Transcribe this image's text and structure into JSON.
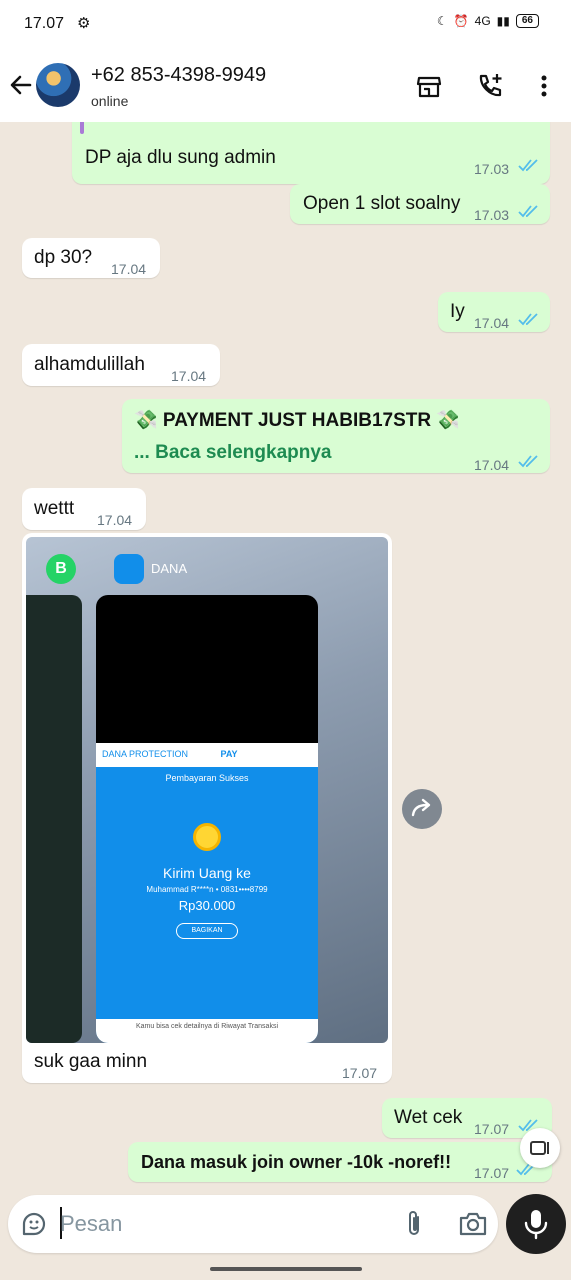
{
  "status_bar": {
    "time": "17.07",
    "network": "4G",
    "battery": "66"
  },
  "header": {
    "contact_name": "+62 853-4398-9949",
    "status": "online"
  },
  "messages": [
    {
      "direction": "out",
      "text": "DP aja dlu sung admin",
      "time": "17.03",
      "read": true
    },
    {
      "direction": "out",
      "text": "Open 1 slot soalny",
      "time": "17.03",
      "read": true
    },
    {
      "direction": "in",
      "text": "dp 30?",
      "time": "17.04"
    },
    {
      "direction": "out",
      "text": "Iy",
      "time": "17.04",
      "read": true
    },
    {
      "direction": "in",
      "text": "alhamdulillah",
      "time": "17.04"
    },
    {
      "direction": "out",
      "text": "💸 PAYMENT JUST HABIB17STR 💸",
      "more": "... Baca selengkapnya",
      "time": "17.04",
      "read": true
    },
    {
      "direction": "in",
      "text": "wettt",
      "time": "17.04"
    },
    {
      "direction": "in",
      "type": "image",
      "caption": "suk gaa minn",
      "time": "17.07"
    },
    {
      "direction": "out",
      "text": "Wet cek",
      "time": "17.07",
      "read": true
    },
    {
      "direction": "out",
      "text": "Dana masuk join owner -10k -noref!!",
      "time": "17.07",
      "read": true
    }
  ],
  "image_content": {
    "app_label": "DANA",
    "brand_left": "DANA PROTECTION",
    "brand_right": "PAY",
    "title": "Pembayaran Sukses",
    "send": "Kirim Uang ke",
    "recipient": "Muhammad R****n • 0831••••8799",
    "amount": "Rp30.000",
    "share": "BAGIKAN",
    "footer": "Kamu bisa cek detailnya di Riwayat Transaksi"
  },
  "input": {
    "placeholder": "Pesan"
  },
  "colors": {
    "outgoing": "#d9fdd3",
    "incoming": "#ffffff",
    "background": "#efe7dd",
    "read_ticks": "#53bdeb",
    "link": "#1e8b51"
  }
}
